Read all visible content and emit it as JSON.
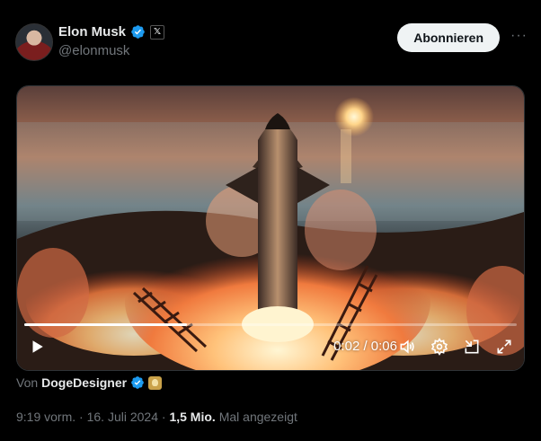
{
  "post": {
    "author": {
      "display_name": "Elon Musk",
      "handle": "@elonmusk",
      "badge_x": "𝕏"
    },
    "follow_label": "Abonnieren",
    "more_label": "···",
    "video": {
      "time_display": "0:02 / 0:06",
      "progress": 0.33
    },
    "attribution": {
      "prefix": "Von",
      "name": "DogeDesigner"
    },
    "meta": {
      "time": "9:19 vorm.",
      "sep1": "·",
      "date": "16. Juli 2024",
      "sep2": "·",
      "views": "1,5 Mio.",
      "views_label": "Mal angezeigt"
    }
  },
  "colors": {
    "verified": "#1d9bf0",
    "secondary_text": "#71767b",
    "follow_bg": "#eff3f4"
  }
}
